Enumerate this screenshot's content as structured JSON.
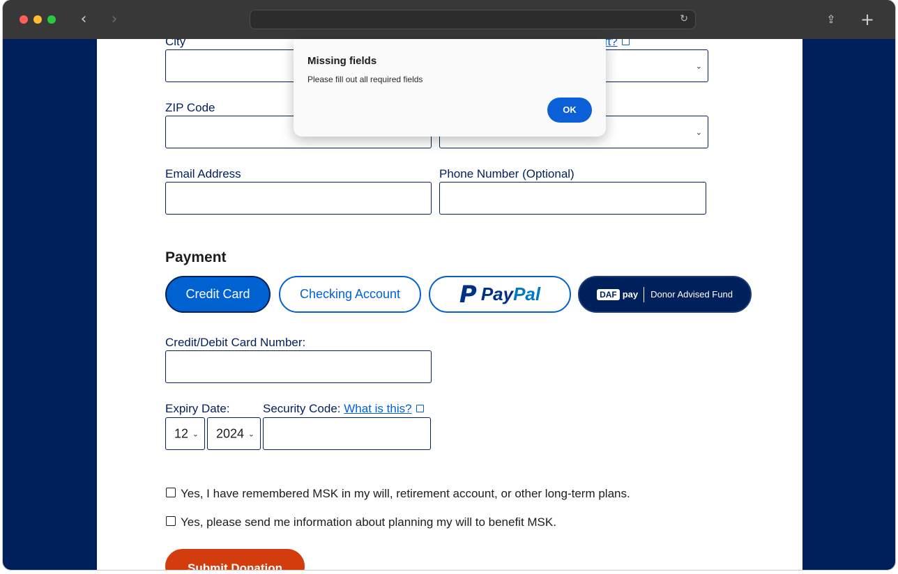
{
  "browser": {
    "back_icon": "‹",
    "forward_icon": "›",
    "reload_icon": "↻",
    "share_icon": "⇪",
    "new_tab_icon": "+"
  },
  "form": {
    "city_label": "City",
    "tribute_link_partial": "ift?",
    "zip_label": "ZIP Code",
    "email_label": "Email Address",
    "phone_label": "Phone Number (Optional)",
    "payment_title": "Payment",
    "payment_options": {
      "credit_card": "Credit Card",
      "checking": "Checking Account",
      "paypal_pay": "Pay",
      "paypal_pal": "Pal",
      "paypal_glyph": "P",
      "daf_box": "DAF",
      "daf_pay": "pay",
      "daf_label": "Donor Advised Fund"
    },
    "card_number_label": "Credit/Debit Card Number:",
    "expiry_label": "Expiry Date:",
    "security_label": "Security Code:",
    "security_link": "What is this?",
    "expiry_month": "12",
    "expiry_year": "2024",
    "select_arrow": "⌄",
    "checkbox_will": "Yes, I have remembered MSK in my will, retirement account, or other long-term plans.",
    "checkbox_info": "Yes, please send me information about planning my will to benefit MSK.",
    "submit_label": "Submit Donation"
  },
  "dialog": {
    "title": "Missing fields",
    "message": "Please fill out all required fields",
    "ok_label": "OK"
  },
  "colors": {
    "navy": "#00205b",
    "blue": "#0061d1",
    "submit_orange": "#d33d0e",
    "dialog_ok": "#0b5fd7"
  }
}
